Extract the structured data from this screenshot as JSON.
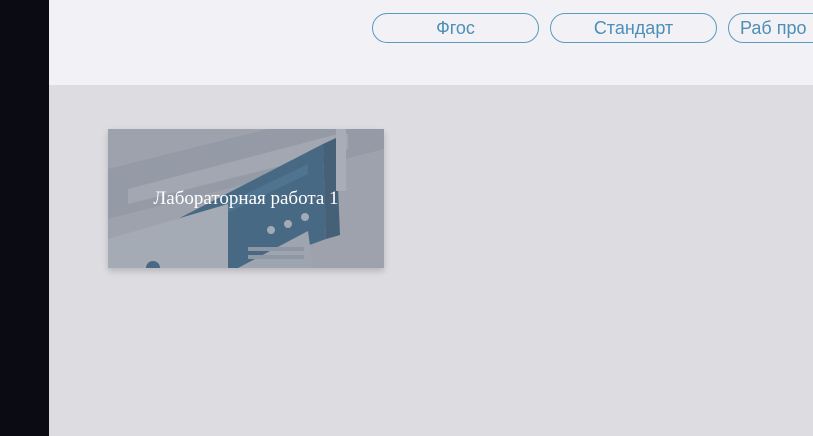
{
  "header": {
    "nav": [
      {
        "label": "Фгос"
      },
      {
        "label": "Стандарт"
      },
      {
        "label": "Раб про"
      }
    ]
  },
  "cards": [
    {
      "title": "Лабораторная работа 1",
      "image_icon": "server-illustration-icon"
    }
  ],
  "colors": {
    "header_bg": "#f2f1f6",
    "content_bg": "#dddce1",
    "sidebar_bg": "#0b0b13",
    "pill_border": "#5c9bbf",
    "pill_text": "#4d8fb6",
    "card_overlay": "#78808e"
  }
}
